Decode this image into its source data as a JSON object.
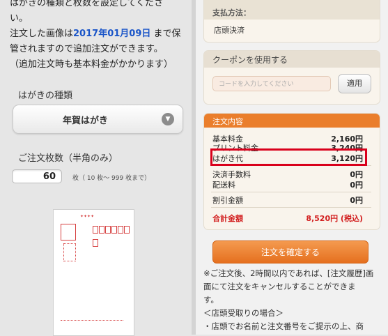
{
  "intro": {
    "line1": "はがきの種類と枚数を設定してくださ",
    "line2": "い。",
    "line3_pre": "注文した画像は",
    "line3_date": "2017年01月09日",
    "line3_post": "まで保",
    "line4": "管されますので追加注文ができます。",
    "line5": "（追加注文時も基本料金がかかります）"
  },
  "type_label": "はがきの種類",
  "type_select": {
    "value": "年賀はがき",
    "icon": "chevron-down-icon"
  },
  "qty_label": "ご注文枚数（半角のみ）",
  "qty": {
    "value": "60",
    "hint": "枚（ 10 枚〜 999 枚まで）"
  },
  "payment": {
    "header": "支払方法：",
    "value": "店頭決済"
  },
  "coupon": {
    "header": "クーポンを使用する",
    "placeholder": "コードを入力してください",
    "apply": "適用"
  },
  "order": {
    "header": "注文内容",
    "rows": [
      {
        "label": "基本料金",
        "value": "2,160円"
      },
      {
        "label": "プリント料金",
        "value": "3,240円"
      },
      {
        "label": "はがき代",
        "value": "3,120円"
      },
      {
        "label": "決済手数料",
        "value": "0円"
      },
      {
        "label": "配送料",
        "value": "0円"
      },
      {
        "label": "割引金額",
        "value": "0円"
      }
    ],
    "total_label": "合計金額",
    "total_value": "8,520円 (税込)"
  },
  "confirm_button": "注文を確定する",
  "notes": {
    "line1": "※ご注文後、2時間以内であれば、[注文履歴]画",
    "line2": "面にて注文をキャンセルすることができま",
    "line3": "す。",
    "line4": "＜店頭受取りの場合＞",
    "line5": "・店頭でお名前と注文番号をご提示の上、商"
  },
  "colors": {
    "accent_orange": "#ea7e2c",
    "date_blue": "#1a55c8",
    "highlight_red": "#d9001b",
    "total_red": "#d21e1e"
  }
}
